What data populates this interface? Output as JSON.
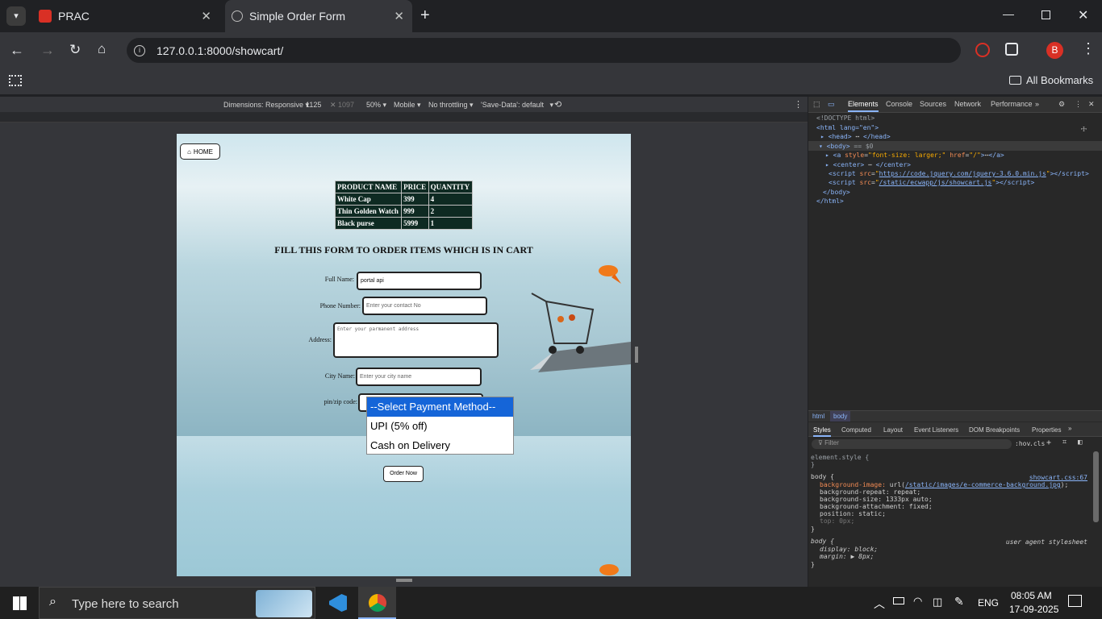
{
  "tabs": [
    {
      "title": "PRAC"
    },
    {
      "title": "Simple Order Form"
    }
  ],
  "url": "127.0.0.1:8000/showcart/",
  "bookmarks_label": "All Bookmarks",
  "profile_initial": "B",
  "emulation": {
    "dimensions": "Dimensions: Responsive",
    "width": "1125",
    "height": "1097",
    "zoom": "50%",
    "device": "Mobile",
    "throttle": "No throttling",
    "save_data": "'Save-Data': default"
  },
  "page": {
    "home_label": "HOME",
    "table": {
      "headers": [
        "PRODUCT NAME",
        "PRICE",
        "QUANTITY"
      ],
      "rows": [
        [
          "White Cap",
          "399",
          "4"
        ],
        [
          "Thin Golden Watch",
          "999",
          "2"
        ],
        [
          "Black purse",
          "5999",
          "1"
        ]
      ]
    },
    "heading": "FILL THIS FORM TO ORDER ITEMS WHICH IS IN CART",
    "form": {
      "fullname_label": "Full Name:",
      "fullname_value": "portal  api",
      "phone_label": "Phone Number:",
      "phone_placeholder": "Enter your contact No",
      "address_label": "Address:",
      "address_placeholder": "Enter your parmanent address",
      "city_label": "City Name:",
      "city_placeholder": "Enter your city name",
      "pin_label": "pin/zip code:"
    },
    "payment_options": [
      "--Select Payment Method--",
      "UPI (5% off)",
      "Cash on Delivery"
    ],
    "order_button": "Order Now"
  },
  "devtools": {
    "tabs": [
      "Elements",
      "Console",
      "Sources",
      "Network",
      "Performance"
    ],
    "dom": {
      "doctype": "<!DOCTYPE html>",
      "html_open": "<html lang=\"en\">",
      "head": "<head>",
      "head_close": "</head>",
      "body_open": "<body>",
      "body_eq": "== $0",
      "a_style": "font-size: larger;",
      "a_href": "/",
      "center_open": "<center>",
      "center_close": "</center>",
      "script1": "https://code.jquery.com/jquery-3.6.0.min.js",
      "script2": "/static/ecwapp/js/showcart.js",
      "body_close": "</body>",
      "html_close": "</html>"
    },
    "crumbs": [
      "html",
      "body"
    ],
    "style_tabs": [
      "Styles",
      "Computed",
      "Layout",
      "Event Listeners",
      "DOM Breakpoints",
      "Properties"
    ],
    "filter_placeholder": "Filter",
    "hov": ":hov",
    "cls": ".cls",
    "rules": {
      "element_style": "element.style {",
      "body_selector": "body {",
      "body_source": "showcart.css:67",
      "bg_image_prop": "background-image:",
      "bg_image_val": "/static/images/e-commerce-background.jpg",
      "bg_repeat": "background-repeat: repeat;",
      "bg_size": "background-size: 1333px auto;",
      "bg_attach": "background-attachment: fixed;",
      "position": "position: static;",
      "top": "top: 0px;",
      "ua_selector": "body {",
      "ua_source": "user agent stylesheet",
      "display": "display: block;",
      "margin": "margin: ▶ 8px;"
    }
  },
  "taskbar": {
    "search_placeholder": "Type here to search",
    "lang": "ENG",
    "time": "08:05 AM",
    "date": "17-09-2025"
  }
}
